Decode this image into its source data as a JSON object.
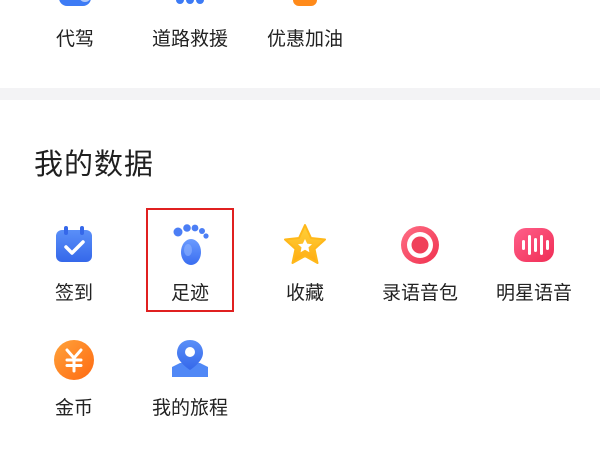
{
  "services": {
    "items": [
      {
        "label": "代驾",
        "icon": "car-icon"
      },
      {
        "label": "道路救援",
        "icon": "tow-truck-icon"
      },
      {
        "label": "优惠加油",
        "icon": "fuel-icon"
      }
    ]
  },
  "my_data": {
    "title": "我的数据",
    "items": [
      {
        "label": "签到",
        "icon": "calendar-check-icon"
      },
      {
        "label": "足迹",
        "icon": "footprint-icon"
      },
      {
        "label": "收藏",
        "icon": "star-icon"
      },
      {
        "label": "录语音包",
        "icon": "record-icon"
      },
      {
        "label": "明星语音",
        "icon": "soundwave-icon"
      },
      {
        "label": "金币",
        "icon": "coin-icon"
      },
      {
        "label": "我的旅程",
        "icon": "map-pin-icon"
      }
    ]
  },
  "colors": {
    "blue": "#3d7bf5",
    "orange": "#ff7a1a",
    "yellow": "#ffc21a",
    "red": "#f0405a",
    "highlight": "#e02020"
  }
}
